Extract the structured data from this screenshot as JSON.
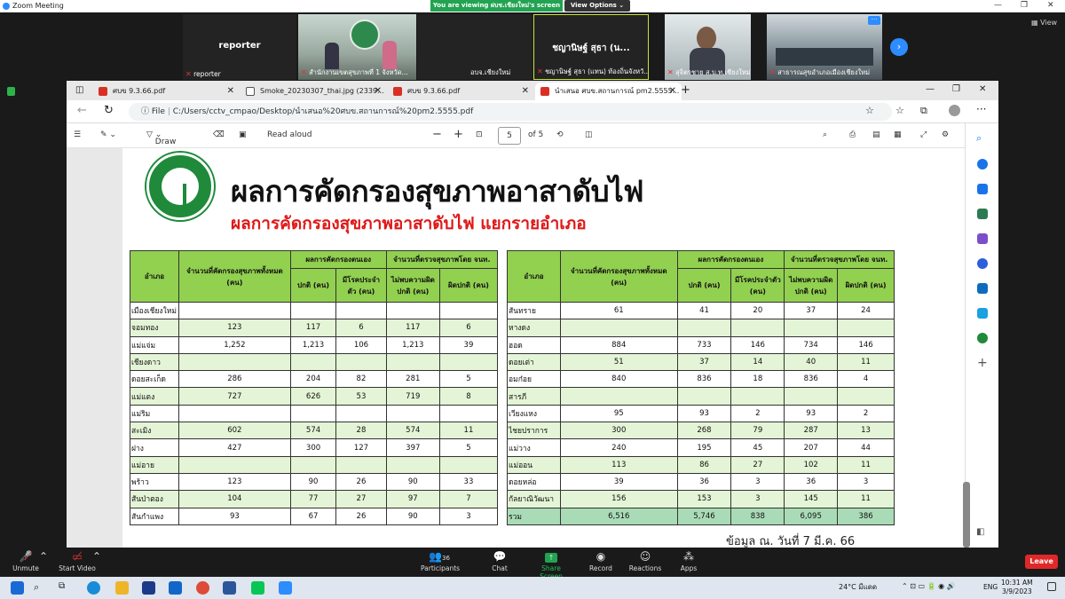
{
  "zoom": {
    "window_title": "Zoom Meeting",
    "viewing_banner": "You are viewing ฝบช.เชียงใหม่'s screen",
    "view_options": "View Options",
    "view_button": "View",
    "participants": [
      {
        "label": "reporter",
        "name": "reporter"
      },
      {
        "label": "",
        "name": "สำนักงานเขตสุขภาพที่ 1 จังหวัด..."
      },
      {
        "label": "",
        "name": "อบจ.เชียงใหม่"
      },
      {
        "label": "ชญานิษฐ์ สุธา (น...",
        "name": "ชญานิษฐ์ สุธา (แทน) ท้องถิ่นจังหวั..."
      },
      {
        "label": "",
        "name": "สุจิตรชาย ส.บ.ท.เชียงใหม่"
      },
      {
        "label": "",
        "name": "สาธารณสุขอำเภอเมืองเชียงใหม่"
      }
    ],
    "controls": {
      "unmute": "Unmute",
      "start_video": "Start Video",
      "participants": "Participants",
      "participants_count": "36",
      "chat": "Chat",
      "share_screen": "Share Screen",
      "record": "Record",
      "reactions": "Reactions",
      "apps": "Apps",
      "leave": "Leave"
    }
  },
  "browser": {
    "tabs": [
      {
        "label": "ศบข 9.3.66.pdf"
      },
      {
        "label": "Smoke_20230307_thai.jpg (2339..."
      },
      {
        "label": "ศบข 9.3.66.pdf"
      },
      {
        "label": "นำเสนอ ศบข.สถานการณ์ pm2.5555..."
      }
    ],
    "url_prefix": "File",
    "url": "C:/Users/cctv_cmpao/Desktop/นำเสนอ%20ศบข.สถานการณ์%20pm2.5555.pdf",
    "draw": "Draw",
    "read_aloud": "Read aloud",
    "page_current": "5",
    "page_total": "of 5"
  },
  "slide": {
    "title": "ผลการคัดกรองสุขภาพอาสาดับไฟ",
    "subtitle": "ผลการคัดกรองสุขภาพอาสาดับไฟ แยกรายอำเภอ",
    "data_note": "ข้อมูล ณ. วันที่ 7 มี.ค. 66",
    "headers": {
      "district": "อำเภอ",
      "total": "จำนวนที่คัดกรองสุขภาพทั้งหมด (คน)",
      "self_group": "ผลการคัดกรองตนเอง",
      "officer_group": "จำนวนที่ตรวจสุขภาพโดย จนท.",
      "normal": "ปกติ (คน)",
      "chronic": "มีโรคประจำตัว (คน)",
      "no_abnormal": "ไม่พบความผิดปกติ (คน)",
      "abnormal": "ผิดปกติ (คน)"
    },
    "left_rows": [
      {
        "d": "เมืองเชียงใหม่",
        "t": "",
        "n": "",
        "c": "",
        "na": "",
        "a": ""
      },
      {
        "d": "จอมทอง",
        "t": "123",
        "n": "117",
        "c": "6",
        "na": "117",
        "a": "6"
      },
      {
        "d": "แม่แจ่ม",
        "t": "1,252",
        "n": "1,213",
        "c": "106",
        "na": "1,213",
        "a": "39"
      },
      {
        "d": "เชียงดาว",
        "t": "",
        "n": "",
        "c": "",
        "na": "",
        "a": ""
      },
      {
        "d": "ดอยสะเก็ด",
        "t": "286",
        "n": "204",
        "c": "82",
        "na": "281",
        "a": "5"
      },
      {
        "d": "แม่แตง",
        "t": "727",
        "n": "626",
        "c": "53",
        "na": "719",
        "a": "8"
      },
      {
        "d": "แม่ริม",
        "t": "",
        "n": "",
        "c": "",
        "na": "",
        "a": ""
      },
      {
        "d": "สะเมิง",
        "t": "602",
        "n": "574",
        "c": "28",
        "na": "574",
        "a": "11"
      },
      {
        "d": "ฝาง",
        "t": "427",
        "n": "300",
        "c": "127",
        "na": "397",
        "a": "5"
      },
      {
        "d": "แม่อาย",
        "t": "",
        "n": "",
        "c": "",
        "na": "",
        "a": ""
      },
      {
        "d": "พร้าว",
        "t": "123",
        "n": "90",
        "c": "26",
        "na": "90",
        "a": "33"
      },
      {
        "d": "สันป่าตอง",
        "t": "104",
        "n": "77",
        "c": "27",
        "na": "97",
        "a": "7"
      },
      {
        "d": "สันกำแพง",
        "t": "93",
        "n": "67",
        "c": "26",
        "na": "90",
        "a": "3"
      }
    ],
    "right_rows": [
      {
        "d": "สันทราย",
        "t": "61",
        "n": "41",
        "c": "20",
        "na": "37",
        "a": "24"
      },
      {
        "d": "หางดง",
        "t": "",
        "n": "",
        "c": "",
        "na": "",
        "a": ""
      },
      {
        "d": "ฮอด",
        "t": "884",
        "n": "733",
        "c": "146",
        "na": "734",
        "a": "146"
      },
      {
        "d": "ดอยเต่า",
        "t": "51",
        "n": "37",
        "c": "14",
        "na": "40",
        "a": "11"
      },
      {
        "d": "อมก๋อย",
        "t": "840",
        "n": "836",
        "c": "18",
        "na": "836",
        "a": "4"
      },
      {
        "d": "สารภี",
        "t": "",
        "n": "",
        "c": "",
        "na": "",
        "a": ""
      },
      {
        "d": "เวียงแหง",
        "t": "95",
        "n": "93",
        "c": "2",
        "na": "93",
        "a": "2"
      },
      {
        "d": "ไชยปราการ",
        "t": "300",
        "n": "268",
        "c": "79",
        "na": "287",
        "a": "13"
      },
      {
        "d": "แม่วาง",
        "t": "240",
        "n": "195",
        "c": "45",
        "na": "207",
        "a": "44"
      },
      {
        "d": "แม่ออน",
        "t": "113",
        "n": "86",
        "c": "27",
        "na": "102",
        "a": "11"
      },
      {
        "d": "ดอยหล่อ",
        "t": "39",
        "n": "36",
        "c": "3",
        "na": "36",
        "a": "3"
      },
      {
        "d": "กัลยาณิวัฒนา",
        "t": "156",
        "n": "153",
        "c": "3",
        "na": "145",
        "a": "11"
      },
      {
        "d": "รวม",
        "t": "6,516",
        "n": "5,746",
        "c": "838",
        "na": "6,095",
        "a": "386"
      }
    ]
  },
  "taskbar": {
    "weather": "24°C มีแดด",
    "lang": "ENG",
    "time": "10:31 AM",
    "date": "3/9/2023"
  }
}
